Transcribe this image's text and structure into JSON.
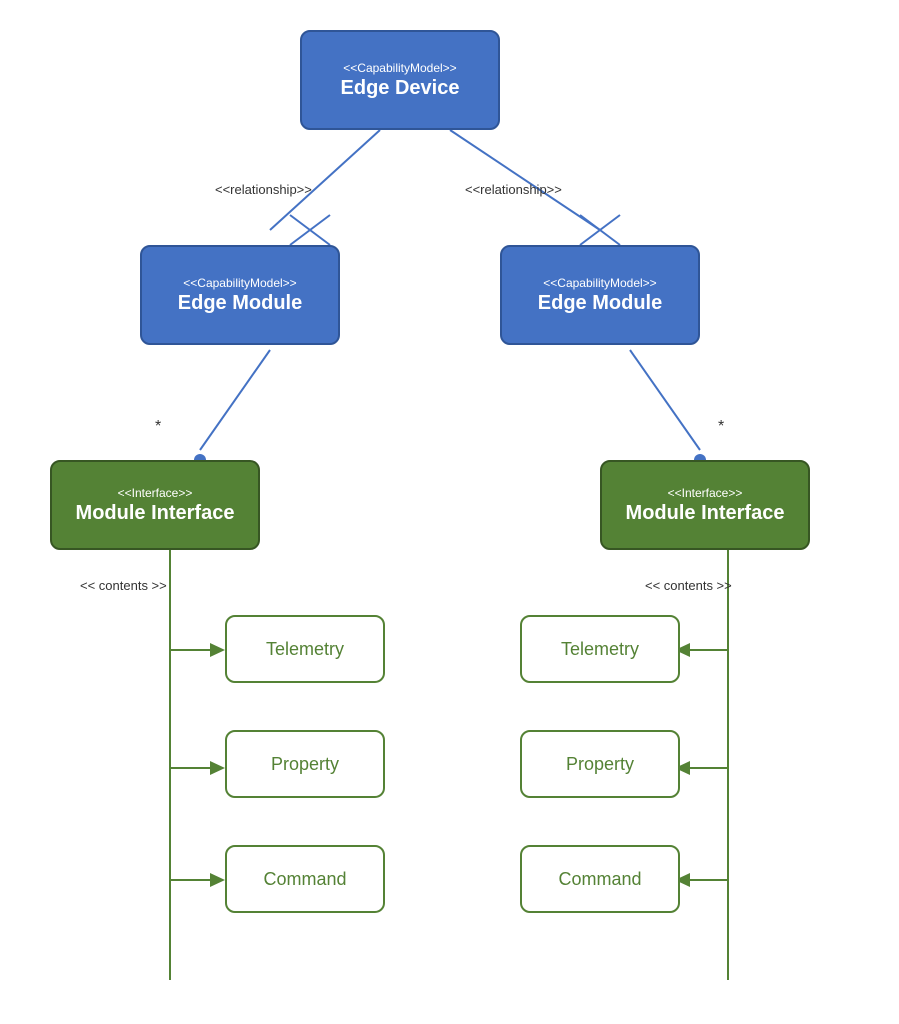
{
  "nodes": {
    "edgeDevice": {
      "stereotype": "<<CapabilityModel>>",
      "title": "Edge Device"
    },
    "edgeModuleLeft": {
      "stereotype": "<<CapabilityModel>>",
      "title": "Edge Module"
    },
    "edgeModuleRight": {
      "stereotype": "<<CapabilityModel>>",
      "title": "Edge Module"
    },
    "moduleInterfaceLeft": {
      "stereotype": "<<Interface>>",
      "title": "Module Interface"
    },
    "moduleInterfaceRight": {
      "stereotype": "<<Interface>>",
      "title": "Module Interface"
    }
  },
  "contents": {
    "leftTelemetry": "Telemetry",
    "leftProperty": "Property",
    "leftCommand": "Command",
    "rightTelemetry": "Telemetry",
    "rightProperty": "Property",
    "rightCommand": "Command"
  },
  "labels": {
    "relationshipLeft": "<<relationship>>",
    "relationshipRight": "<<relationship>>",
    "contentsLeft": "<< contents >>",
    "contentsRight": "<< contents >>",
    "multiplicityLeft": "*",
    "multiplicityRight": "*"
  }
}
